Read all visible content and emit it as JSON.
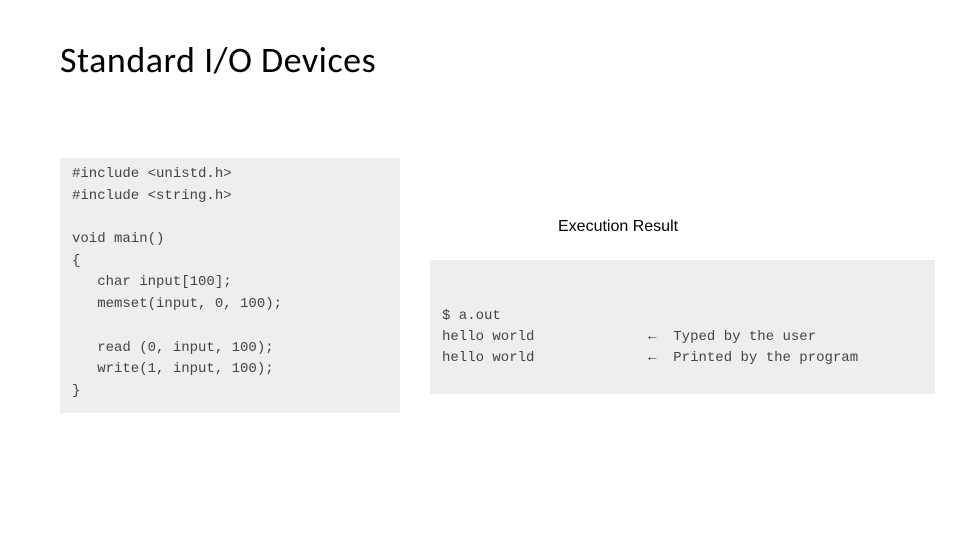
{
  "title": "Standard I/O Devices",
  "result_label": "Execution Result",
  "code": {
    "l1": "#include <unistd.h>",
    "l2": "#include <string.h>",
    "l3": "",
    "l4": "void main()",
    "l5": "{",
    "l6": "   char input[100];",
    "l7": "   memset(input, 0, 100);",
    "l8": "",
    "l9": "   read (0, input, 100);",
    "l10": "   write(1, input, 100);",
    "l11": "}"
  },
  "result": {
    "rows": [
      {
        "left": "$ a.out",
        "right": ""
      },
      {
        "left": "hello world",
        "right": "←  Typed by the user"
      },
      {
        "left": "hello world",
        "right": "←  Printed by the program"
      }
    ]
  }
}
